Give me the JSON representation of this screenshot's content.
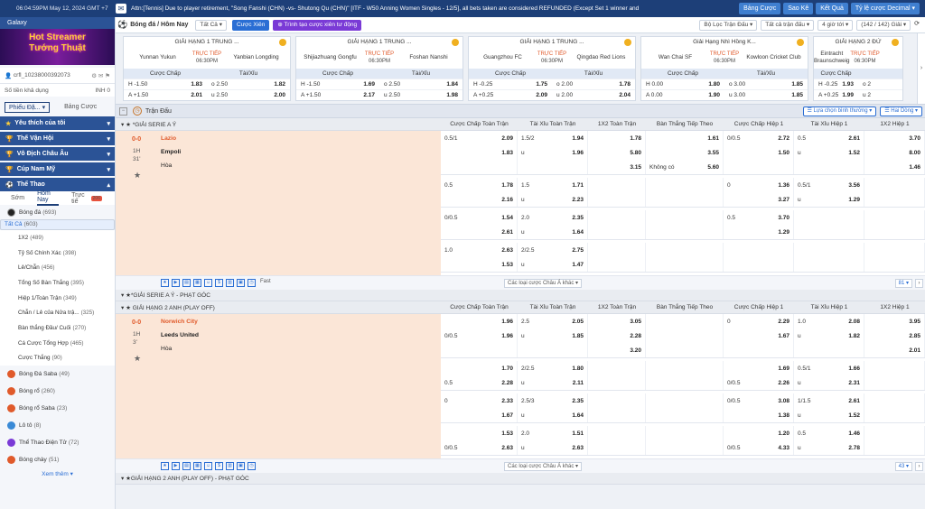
{
  "topbar": {
    "clock": "06:04:59PM May 12, 2024 GMT +7",
    "ticker": "Attn:[Tennis] Due to player retirement, \"Song Fanshi (CHN) -vs- Shutong Qu (CHN)\" [ITF - W50 Anning Women Singles - 12/5], all bets taken are considered REFUNDED (Except Set 1 winner and",
    "buttons": [
      "Bảng Cược",
      "Sao Kê",
      "Kết Quả",
      "Tỷ lệ cược Decimal"
    ]
  },
  "sidebar": {
    "galaxy": "Galaxy",
    "banner": [
      "Hot Streamer",
      "Tướng Thuật"
    ],
    "account": "crfl_10238000392073",
    "balance_label": "Số tiền khả dụng",
    "balance_value": "INH 0",
    "tab_active": "Phiếu Đặ...",
    "tab_other": "Bảng Cược",
    "sections": [
      "Yêu thích của tôi",
      "Thế Vận Hội",
      "Vô Địch Châu Âu",
      "Cúp Nam Mỹ",
      "Thể Thao"
    ],
    "subtabs": [
      "Sớm",
      "Hôm Nay",
      "Trực tiế"
    ],
    "subtab_badge": "206",
    "sport": "Bóng đá",
    "sport_count": "(693)",
    "subs": [
      {
        "label": "Tất Cả",
        "count": "(603)"
      },
      {
        "label": "1X2",
        "count": "(489)"
      },
      {
        "label": "Tỷ Số Chính Xác",
        "count": "(398)"
      },
      {
        "label": "Lẻ/Chẵn",
        "count": "(456)"
      },
      {
        "label": "Tổng Số Bàn Thắng",
        "count": "(395)"
      },
      {
        "label": "Hiệp 1/Toàn Trận",
        "count": "(349)"
      },
      {
        "label": "Chẵn / Lẻ của Nửa trậ...",
        "count": "(325)"
      },
      {
        "label": "Bàn thắng Đầu/ Cuối",
        "count": "(270)"
      },
      {
        "label": "Cá Cược Tổng Hợp",
        "count": "(465)"
      },
      {
        "label": "Cược Thắng",
        "count": "(90)"
      }
    ],
    "others": [
      {
        "label": "Bóng Đá Saba",
        "count": "(49)"
      },
      {
        "label": "Bóng rổ",
        "count": "(260)"
      },
      {
        "label": "Bóng rổ Saba",
        "count": "(23)"
      },
      {
        "label": "Lô tô",
        "count": "(8)"
      },
      {
        "label": "Thể Thao Điện Tử",
        "count": "(72)"
      },
      {
        "label": "Bóng chày",
        "count": "(51)"
      }
    ],
    "more": "Xem thêm"
  },
  "main": {
    "title": "Bóng đá / Hôm Nay",
    "filter": "Tất Cả",
    "btn_cuoc_xien": "Cược Xiên",
    "btn_tao": "Trình tạo cược xiên tư động",
    "right": [
      "Bộ Lọc Trận Đấu",
      "Tất cả trận đấu",
      "4 giờ tới",
      "(142 / 142) Giải"
    ],
    "cards": [
      {
        "league": "GIẢI HẠNG 1 TRUNG ...",
        "home": "Yunnan Yukun",
        "away": "Yanbian Longding",
        "live": "TRỰC TIẾP",
        "time": "06:30PM",
        "h1": "Cược Chấp",
        "h2": "Tài/Xỉu",
        "rows": [
          [
            "H -1.50",
            "1.83",
            "o 2.50",
            "1.82"
          ],
          [
            "A +1.50",
            "2.01",
            "u 2.50",
            "2.00"
          ]
        ]
      },
      {
        "league": "GIẢI HẠNG 1 TRUNG ...",
        "home": "Shijiazhuang Gongfu",
        "away": "Foshan Nanshi",
        "live": "TRỰC TIẾP",
        "time": "06:30PM",
        "h1": "Cược Chấp",
        "h2": "Tài/Xỉu",
        "rows": [
          [
            "H -1.50",
            "1.69",
            "o 2.50",
            "1.84"
          ],
          [
            "A +1.50",
            "2.17",
            "u 2.50",
            "1.98"
          ]
        ]
      },
      {
        "league": "GIẢI HẠNG 1 TRUNG ...",
        "home": "Guangzhou FC",
        "away": "Qingdao Red Lions",
        "live": "TRỰC TIẾP",
        "time": "06:30PM",
        "h1": "Cược Chấp",
        "h2": "Tài/Xỉu",
        "rows": [
          [
            "H -0.25",
            "1.75",
            "o 2.00",
            "1.78"
          ],
          [
            "A +0.25",
            "2.09",
            "u 2.00",
            "2.04"
          ]
        ]
      },
      {
        "league": "Giải Hạng Nhì Hồng K...",
        "home": "Wan Chai SF",
        "away": "Kowloon Cricket Club",
        "live": "TRỰC TIẾP",
        "time": "06:30PM",
        "h1": "Cược Chấp",
        "h2": "Tài/Xỉu",
        "rows": [
          [
            "H 0.00",
            "1.80",
            "o 3.00",
            "1.85"
          ],
          [
            "A 0.00",
            "1.90",
            "u 3.00",
            "1.85"
          ]
        ]
      },
      {
        "league": "GIẢI HẠNG 2 ĐỨ",
        "home": "Eintracht Braunschweig",
        "away": "",
        "live": "TRỰC TIẾP",
        "time": "06:30PM",
        "h1": "Cược Chấp",
        "h2": "",
        "rows": [
          [
            "H -0.25",
            "1.93",
            "o 2",
            ""
          ],
          [
            "A +0.25",
            "1.99",
            "u 2",
            ""
          ]
        ]
      }
    ],
    "bar": {
      "title": "Trận Đấu",
      "sort": "Lựa chọn bình thường",
      "view": "Hai Dòng"
    },
    "cols": [
      "Cược Chấp Toàn Trận",
      "Tài Xỉu Toàn Trận",
      "1X2 Toàn Trận",
      "Bàn Thắng Tiếp Theo",
      "Cược Chấp Hiệp 1",
      "Tài Xỉu Hiệp 1",
      "1X2 Hiệp 1"
    ],
    "league1": "*GIẢI SERIE A Ý",
    "match1": {
      "score": "0-0",
      "period": "1H",
      "minute": "31'",
      "home": "Lazio",
      "away": "Empoli",
      "draw": "Hòa",
      "groups": [
        [
          [
            "0.5/1",
            "2.09",
            "1.5/2",
            "1.94",
            "",
            "1.78",
            "",
            "1.61",
            "0/0.5",
            "2.72",
            "0.5",
            "2.61",
            "",
            "3.70"
          ],
          [
            "",
            "1.83",
            "u",
            "1.96",
            "",
            "5.80",
            "",
            "3.55",
            "",
            "1.50",
            "u",
            "1.52",
            "",
            "8.00"
          ],
          [
            "",
            "",
            "",
            "",
            "",
            "3.15",
            "Không có",
            "5.60",
            "",
            "",
            "",
            "",
            "",
            "1.46"
          ]
        ],
        [
          [
            "0.5",
            "1.78",
            "1.5",
            "1.71",
            "",
            "",
            "",
            "",
            "0",
            "1.36",
            "0.5/1",
            "3.56",
            "",
            ""
          ],
          [
            "",
            "2.16",
            "u",
            "2.23",
            "",
            "",
            "",
            "",
            "",
            "3.27",
            "u",
            "1.29",
            "",
            ""
          ]
        ],
        [
          [
            "0/0.5",
            "1.54",
            "2.0",
            "2.35",
            "",
            "",
            "",
            "",
            "0.5",
            "3.70",
            "",
            "",
            "",
            ""
          ],
          [
            "",
            "2.61",
            "u",
            "1.64",
            "",
            "",
            "",
            "",
            "",
            "1.29",
            "",
            "",
            "",
            ""
          ]
        ],
        [
          [
            "1.0",
            "2.63",
            "2/2.5",
            "2.75",
            "",
            "",
            "",
            "",
            "",
            "",
            "",
            "",
            "",
            ""
          ],
          [
            "",
            "1.53",
            "u",
            "1.47",
            "",
            "",
            "",
            "",
            "",
            "",
            "",
            "",
            "",
            ""
          ]
        ]
      ],
      "fast": "Fast",
      "more": "Các loại cược Châu Á khác",
      "page": "81"
    },
    "league2": "*GIẢI SERIE A Ý - PHẠT GÓC",
    "league3": "GIẢI HẠNG 2 ANH (PLAY OFF)",
    "match2": {
      "score": "0-0",
      "period": "1H",
      "minute": "3'",
      "home": "Norwich City",
      "away": "Leeds United",
      "draw": "Hòa",
      "groups": [
        [
          [
            "",
            "1.96",
            "2.5",
            "2.05",
            "",
            "3.05",
            "",
            "",
            "0",
            "2.29",
            "1.0",
            "2.08",
            "",
            "3.95"
          ],
          [
            "0/0.5",
            "1.96",
            "u",
            "1.85",
            "",
            "2.28",
            "",
            "",
            "",
            "1.67",
            "u",
            "1.82",
            "",
            "2.85"
          ],
          [
            "",
            "",
            "",
            "",
            "",
            "3.20",
            "",
            "",
            "",
            "",
            "",
            "",
            "",
            "2.01"
          ]
        ],
        [
          [
            "",
            "1.70",
            "2/2.5",
            "1.80",
            "",
            "",
            "",
            "",
            "",
            "1.69",
            "0.5/1",
            "1.66",
            "",
            ""
          ],
          [
            "0.5",
            "2.28",
            "u",
            "2.11",
            "",
            "",
            "",
            "",
            "0/0.5",
            "2.26",
            "u",
            "2.31",
            "",
            ""
          ]
        ],
        [
          [
            "0",
            "2.33",
            "2.5/3",
            "2.35",
            "",
            "",
            "",
            "",
            "0/0.5",
            "3.08",
            "1/1.5",
            "2.61",
            "",
            ""
          ],
          [
            "",
            "1.67",
            "u",
            "1.64",
            "",
            "",
            "",
            "",
            "",
            "1.38",
            "u",
            "1.52",
            "",
            ""
          ]
        ],
        [
          [
            "",
            "1.53",
            "2.0",
            "1.51",
            "",
            "",
            "",
            "",
            "",
            "1.20",
            "0.5",
            "1.46",
            "",
            ""
          ],
          [
            "0/0.5",
            "2.63",
            "u",
            "2.63",
            "",
            "",
            "",
            "",
            "0/0.5",
            "4.33",
            "u",
            "2.78",
            "",
            ""
          ]
        ]
      ],
      "more": "Các loại cược Châu Á khác",
      "page": "43"
    },
    "league4": "GIẢI HẠNG 2 ANH (PLAY OFF) - PHẠT GÓC"
  }
}
